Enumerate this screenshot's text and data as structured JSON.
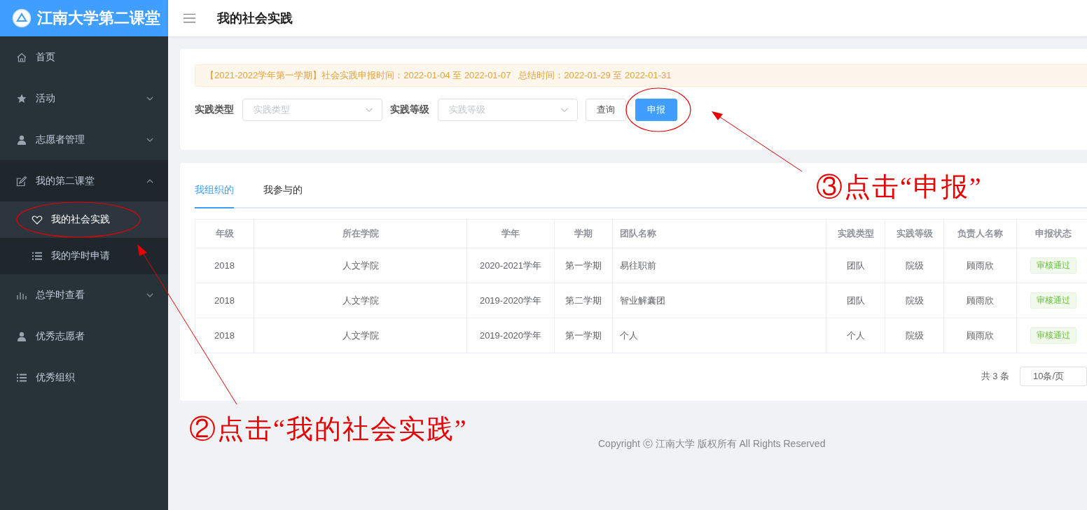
{
  "app": {
    "title": "江南大学第二课堂"
  },
  "page_title": "我的社会实践",
  "sidebar": {
    "items": [
      {
        "label": "首页",
        "selected": false
      },
      {
        "label": "活动",
        "selected": false,
        "expanded": false
      },
      {
        "label": "志愿者管理",
        "selected": false,
        "expanded": false
      },
      {
        "label": "我的第二课堂",
        "selected": false,
        "expanded": true,
        "children": [
          {
            "label": "我的社会实践",
            "selected": true
          },
          {
            "label": "我的学时申请",
            "selected": false
          }
        ]
      },
      {
        "label": "总学时查看",
        "selected": false,
        "expanded": false
      },
      {
        "label": "优秀志愿者",
        "selected": false
      },
      {
        "label": "优秀组织",
        "selected": false
      }
    ]
  },
  "notice": "【2021-2022学年第一学期】社会实践申报时间：2022-01-04 至 2022-01-07   总结时间：2022-01-29 至 2022-01-31",
  "filters": [
    {
      "label": "实践类型",
      "placeholder": "实践类型"
    },
    {
      "label": "实践等级",
      "placeholder": "实践等级"
    }
  ],
  "buttons": [
    {
      "label": "查询",
      "kind": "default"
    },
    {
      "label": "申报",
      "kind": "primary"
    }
  ],
  "tabs": [
    {
      "label": "我组织的",
      "selected": true
    },
    {
      "label": "我参与的",
      "selected": false
    }
  ],
  "table": {
    "columns": [
      "年级",
      "所在学院",
      "学年",
      "学期",
      "团队名称",
      "实践类型",
      "实践等级",
      "负责人名称",
      "申报状态"
    ],
    "rows": [
      [
        "2018",
        "人文学院",
        "2020-2021学年",
        "第一学期",
        "易往职前",
        "团队",
        "院级",
        "顾雨欣",
        "审核通过"
      ],
      [
        "2018",
        "人文学院",
        "2019-2020学年",
        "第二学期",
        "智业解囊团",
        "团队",
        "院级",
        "顾雨欣",
        "审核通过"
      ],
      [
        "2018",
        "人文学院",
        "2019-2020学年",
        "第一学期",
        "个人",
        "个人",
        "院级",
        "顾雨欣",
        "审核通过"
      ]
    ]
  },
  "pagination": {
    "total": "共 3 条",
    "page_size": "10条/页"
  },
  "footer": "Copyright ⓒ 江南大学 版权所有 All Rights Reserved",
  "annotations": [
    {
      "text": "②点击“我的社会实践”"
    },
    {
      "text": "③点击“申报”"
    }
  ]
}
